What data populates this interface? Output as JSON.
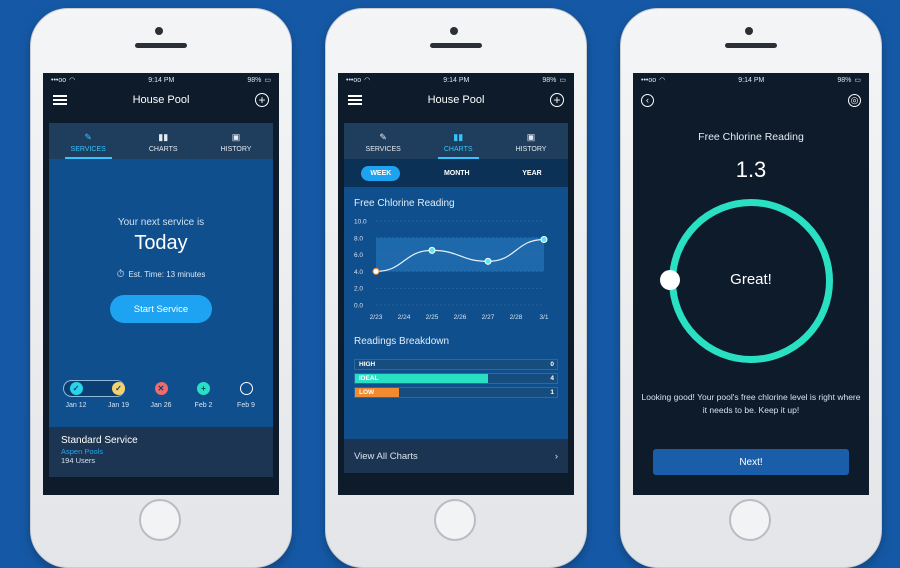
{
  "status": {
    "time": "9:14 PM",
    "battery": "98%",
    "signal": "•••oo"
  },
  "screen1": {
    "title": "House Pool",
    "tabs": [
      {
        "label": "SERVICES",
        "icon": "wrench-icon",
        "active": true
      },
      {
        "label": "CHARTS",
        "icon": "bar-chart-icon",
        "active": false
      },
      {
        "label": "HISTORY",
        "icon": "calendar-icon",
        "active": false
      }
    ],
    "next_service_label": "Your next service is",
    "next_service_value": "Today",
    "est_time": "Est. Time: 13 minutes",
    "start_button": "Start Service",
    "timeline": [
      {
        "date": "Jan 12",
        "status": "complete",
        "color": "#29d3e8"
      },
      {
        "date": "Jan 19",
        "status": "complete",
        "color": "#f5d36a"
      },
      {
        "date": "Jan 26",
        "status": "missed",
        "color": "#f26a6a"
      },
      {
        "date": "Feb 2",
        "status": "upcoming",
        "color": "#29e0c2"
      },
      {
        "date": "Feb 9",
        "status": "scheduled",
        "color": "#ffffff"
      }
    ],
    "service": {
      "name": "Standard Service",
      "company": "Aspen Pools",
      "users": "194 Users"
    }
  },
  "screen2": {
    "title": "House Pool",
    "tabs": [
      {
        "label": "SERVICES",
        "icon": "wrench-icon",
        "active": false
      },
      {
        "label": "CHARTS",
        "icon": "bar-chart-icon",
        "active": true
      },
      {
        "label": "HISTORY",
        "icon": "calendar-icon",
        "active": false
      }
    ],
    "ranges": [
      {
        "label": "WEEK",
        "active": true
      },
      {
        "label": "MONTH",
        "active": false
      },
      {
        "label": "YEAR",
        "active": false
      }
    ],
    "chart_title": "Free Chlorine Reading",
    "breakdown_title": "Readings Breakdown",
    "breakdown": [
      {
        "label": "HIGH",
        "count": "0",
        "fraction": 0,
        "color": "#1d5a92"
      },
      {
        "label": "IDEAL",
        "count": "4",
        "fraction": 0.66,
        "color": "#29e0c2"
      },
      {
        "label": "LOW",
        "count": "1",
        "fraction": 0.22,
        "color": "#f28a30"
      }
    ],
    "view_all": "View All Charts"
  },
  "screen3": {
    "title": "Free Chlorine Reading",
    "value": "1.3",
    "status": "Great!",
    "message": "Looking good! Your pool's free chlorine level is right where it needs to be. Keep it up!",
    "next_button": "Next!"
  },
  "chart_data": {
    "type": "line",
    "title": "Free Chlorine Reading",
    "x": [
      "2/23",
      "2/24",
      "2/25",
      "2/26",
      "2/27",
      "2/28",
      "3/1"
    ],
    "points": [
      {
        "x": "2/23",
        "y": 4.0
      },
      {
        "x": "2/25",
        "y": 6.5
      },
      {
        "x": "2/27",
        "y": 5.2
      },
      {
        "x": "3/1",
        "y": 7.8
      }
    ],
    "yticks": [
      "10.0",
      "8.0",
      "6.0",
      "4.0",
      "2.0",
      "0.0"
    ],
    "ylim": [
      0,
      10
    ],
    "ideal_band": [
      4,
      8
    ],
    "grid": true
  }
}
